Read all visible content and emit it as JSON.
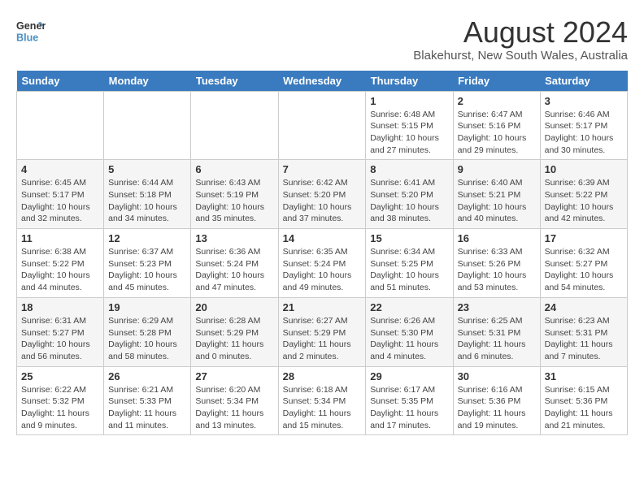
{
  "header": {
    "logo_line1": "General",
    "logo_line2": "Blue",
    "title": "August 2024",
    "subtitle": "Blakehurst, New South Wales, Australia"
  },
  "days_of_week": [
    "Sunday",
    "Monday",
    "Tuesday",
    "Wednesday",
    "Thursday",
    "Friday",
    "Saturday"
  ],
  "weeks": [
    [
      {
        "day": "",
        "detail": ""
      },
      {
        "day": "",
        "detail": ""
      },
      {
        "day": "",
        "detail": ""
      },
      {
        "day": "",
        "detail": ""
      },
      {
        "day": "1",
        "detail": "Sunrise: 6:48 AM\nSunset: 5:15 PM\nDaylight: 10 hours\nand 27 minutes."
      },
      {
        "day": "2",
        "detail": "Sunrise: 6:47 AM\nSunset: 5:16 PM\nDaylight: 10 hours\nand 29 minutes."
      },
      {
        "day": "3",
        "detail": "Sunrise: 6:46 AM\nSunset: 5:17 PM\nDaylight: 10 hours\nand 30 minutes."
      }
    ],
    [
      {
        "day": "4",
        "detail": "Sunrise: 6:45 AM\nSunset: 5:17 PM\nDaylight: 10 hours\nand 32 minutes."
      },
      {
        "day": "5",
        "detail": "Sunrise: 6:44 AM\nSunset: 5:18 PM\nDaylight: 10 hours\nand 34 minutes."
      },
      {
        "day": "6",
        "detail": "Sunrise: 6:43 AM\nSunset: 5:19 PM\nDaylight: 10 hours\nand 35 minutes."
      },
      {
        "day": "7",
        "detail": "Sunrise: 6:42 AM\nSunset: 5:20 PM\nDaylight: 10 hours\nand 37 minutes."
      },
      {
        "day": "8",
        "detail": "Sunrise: 6:41 AM\nSunset: 5:20 PM\nDaylight: 10 hours\nand 38 minutes."
      },
      {
        "day": "9",
        "detail": "Sunrise: 6:40 AM\nSunset: 5:21 PM\nDaylight: 10 hours\nand 40 minutes."
      },
      {
        "day": "10",
        "detail": "Sunrise: 6:39 AM\nSunset: 5:22 PM\nDaylight: 10 hours\nand 42 minutes."
      }
    ],
    [
      {
        "day": "11",
        "detail": "Sunrise: 6:38 AM\nSunset: 5:22 PM\nDaylight: 10 hours\nand 44 minutes."
      },
      {
        "day": "12",
        "detail": "Sunrise: 6:37 AM\nSunset: 5:23 PM\nDaylight: 10 hours\nand 45 minutes."
      },
      {
        "day": "13",
        "detail": "Sunrise: 6:36 AM\nSunset: 5:24 PM\nDaylight: 10 hours\nand 47 minutes."
      },
      {
        "day": "14",
        "detail": "Sunrise: 6:35 AM\nSunset: 5:24 PM\nDaylight: 10 hours\nand 49 minutes."
      },
      {
        "day": "15",
        "detail": "Sunrise: 6:34 AM\nSunset: 5:25 PM\nDaylight: 10 hours\nand 51 minutes."
      },
      {
        "day": "16",
        "detail": "Sunrise: 6:33 AM\nSunset: 5:26 PM\nDaylight: 10 hours\nand 53 minutes."
      },
      {
        "day": "17",
        "detail": "Sunrise: 6:32 AM\nSunset: 5:27 PM\nDaylight: 10 hours\nand 54 minutes."
      }
    ],
    [
      {
        "day": "18",
        "detail": "Sunrise: 6:31 AM\nSunset: 5:27 PM\nDaylight: 10 hours\nand 56 minutes."
      },
      {
        "day": "19",
        "detail": "Sunrise: 6:29 AM\nSunset: 5:28 PM\nDaylight: 10 hours\nand 58 minutes."
      },
      {
        "day": "20",
        "detail": "Sunrise: 6:28 AM\nSunset: 5:29 PM\nDaylight: 11 hours\nand 0 minutes."
      },
      {
        "day": "21",
        "detail": "Sunrise: 6:27 AM\nSunset: 5:29 PM\nDaylight: 11 hours\nand 2 minutes."
      },
      {
        "day": "22",
        "detail": "Sunrise: 6:26 AM\nSunset: 5:30 PM\nDaylight: 11 hours\nand 4 minutes."
      },
      {
        "day": "23",
        "detail": "Sunrise: 6:25 AM\nSunset: 5:31 PM\nDaylight: 11 hours\nand 6 minutes."
      },
      {
        "day": "24",
        "detail": "Sunrise: 6:23 AM\nSunset: 5:31 PM\nDaylight: 11 hours\nand 7 minutes."
      }
    ],
    [
      {
        "day": "25",
        "detail": "Sunrise: 6:22 AM\nSunset: 5:32 PM\nDaylight: 11 hours\nand 9 minutes."
      },
      {
        "day": "26",
        "detail": "Sunrise: 6:21 AM\nSunset: 5:33 PM\nDaylight: 11 hours\nand 11 minutes."
      },
      {
        "day": "27",
        "detail": "Sunrise: 6:20 AM\nSunset: 5:34 PM\nDaylight: 11 hours\nand 13 minutes."
      },
      {
        "day": "28",
        "detail": "Sunrise: 6:18 AM\nSunset: 5:34 PM\nDaylight: 11 hours\nand 15 minutes."
      },
      {
        "day": "29",
        "detail": "Sunrise: 6:17 AM\nSunset: 5:35 PM\nDaylight: 11 hours\nand 17 minutes."
      },
      {
        "day": "30",
        "detail": "Sunrise: 6:16 AM\nSunset: 5:36 PM\nDaylight: 11 hours\nand 19 minutes."
      },
      {
        "day": "31",
        "detail": "Sunrise: 6:15 AM\nSunset: 5:36 PM\nDaylight: 11 hours\nand 21 minutes."
      }
    ]
  ]
}
